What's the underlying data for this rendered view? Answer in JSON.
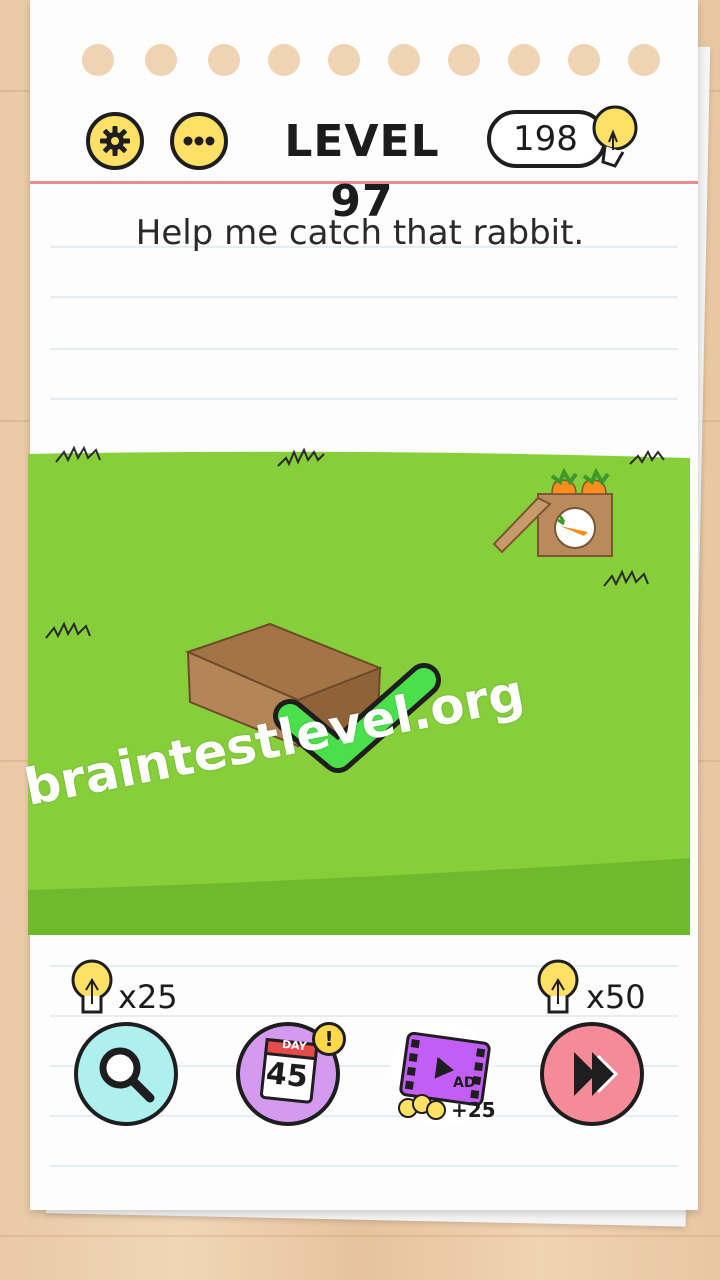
{
  "header": {
    "level_label": "LEVEL 97",
    "hint_count": "198",
    "settings_icon": "gear-icon",
    "menu_icon": "more-dots-icon",
    "hint_icon": "lightbulb-icon"
  },
  "prompt": {
    "text": "Help me catch that rabbit."
  },
  "scene": {
    "objects": [
      "cardboard-box",
      "carrot-box",
      "check-mark"
    ],
    "colors": {
      "grass": "#86cf3a",
      "grass_dark": "#6eb92c",
      "check": "#4be04b"
    }
  },
  "watermark": {
    "text": "braintestlevel.org"
  },
  "tools": {
    "search": {
      "cost": "x25",
      "icon": "magnifier-icon"
    },
    "daily": {
      "day_label": "DAY",
      "day_number": "45",
      "badge": "!"
    },
    "ad": {
      "label": "AD",
      "reward": "+25"
    },
    "skip": {
      "cost": "x50",
      "icon": "fast-forward-icon"
    }
  }
}
